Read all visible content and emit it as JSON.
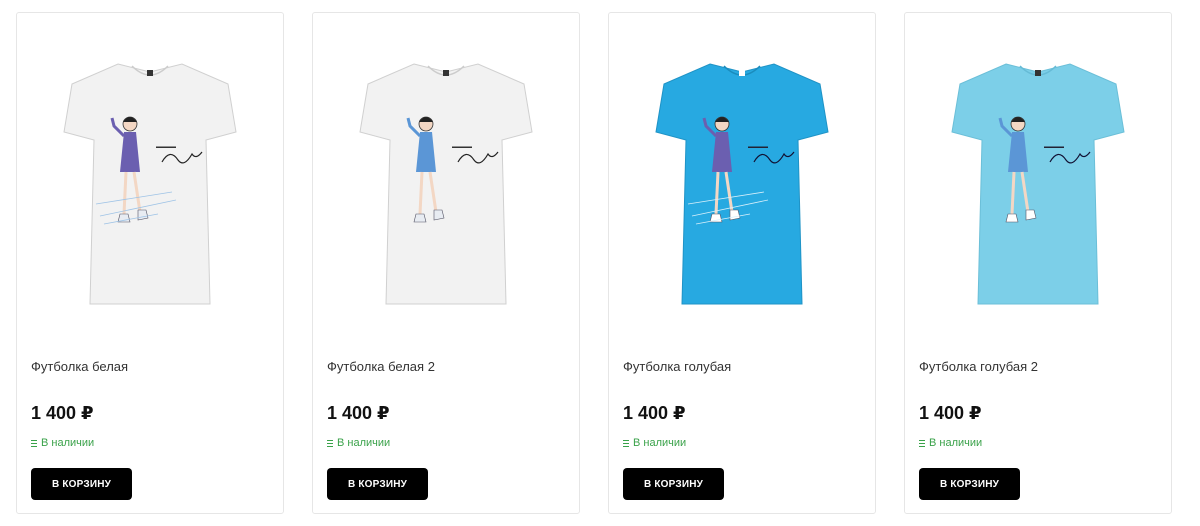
{
  "products": [
    {
      "title": "Футболка белая",
      "price": "1 400 ₽",
      "stock": "В наличии",
      "button": "В КОРЗИНУ",
      "shirt_color": "#f2f2f2",
      "dress_color": "#6b5fb0"
    },
    {
      "title": "Футболка белая 2",
      "price": "1 400 ₽",
      "stock": "В наличии",
      "button": "В КОРЗИНУ",
      "shirt_color": "#f2f2f2",
      "dress_color": "#5b96d6"
    },
    {
      "title": "Футболка голубая",
      "price": "1 400 ₽",
      "stock": "В наличии",
      "button": "В КОРЗИНУ",
      "shirt_color": "#27a9e1",
      "dress_color": "#6b5fb0"
    },
    {
      "title": "Футболка голубая 2",
      "price": "1 400 ₽",
      "stock": "В наличии",
      "button": "В КОРЗИНУ",
      "shirt_color": "#7ccfe8",
      "dress_color": "#5b96d6"
    }
  ],
  "colors": {
    "stock_green": "#3aa24a",
    "button_bg": "#000000"
  }
}
